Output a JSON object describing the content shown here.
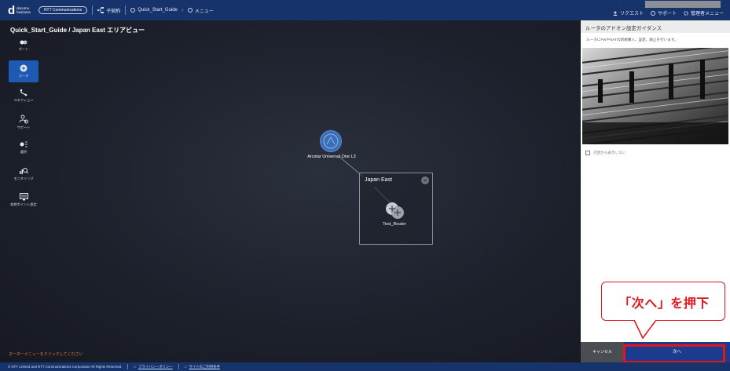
{
  "header": {
    "logo_main": "d",
    "logo_sub_line1": "docomo",
    "logo_sub_line2": "business",
    "ntt_logo": "NTT Communications",
    "contract_label": "子契約",
    "breadcrumb": [
      "Quick_Start_Guide",
      "メニュー"
    ],
    "right_links": [
      "リクエスト",
      "サポート",
      "管理者メニュー"
    ]
  },
  "canvas": {
    "area_title": "Quick_Start_Guide / Japan East エリアビュー",
    "sidebar": [
      {
        "label": "ポート",
        "icon": "port-icon"
      },
      {
        "label": "ルータ",
        "icon": "router-icon",
        "active": true
      },
      {
        "label": "コネクション",
        "icon": "connection-icon"
      },
      {
        "label": "サポート",
        "icon": "support-icon"
      },
      {
        "label": "選択",
        "icon": "select-icon"
      },
      {
        "label": "モニタリング",
        "icon": "monitoring-icon"
      },
      {
        "label": "仮想ポイント設定",
        "icon": "virtual-point-icon"
      }
    ],
    "cloud_node_label": "Arcstar Universal One L3",
    "region_title": "Japan East",
    "router_node_label": "Test_Router",
    "hint": "オーダーメニューをクリックしてください"
  },
  "footer": {
    "copyright": "© NTT Limited and NTT Communications Corporation All Rights Reserved.",
    "privacy_link": "プライバシーポリシー",
    "terms_link": "サイトのご利用条件"
  },
  "guide": {
    "title": "ルータのアドオン設定ガイダンス",
    "description": "ルータにFWやNATの新規購入、設定、廃止を行います。",
    "checkbox_label": "次回から表示しない",
    "cancel_label": "キャンセル",
    "next_label": "次へ"
  },
  "callout": {
    "text": "「次へ」を押下"
  },
  "colors": {
    "header_bg": "#16336b",
    "accent_red": "#e0161c",
    "next_button": "#1b3c8e",
    "hint_orange": "#e57a2b"
  }
}
